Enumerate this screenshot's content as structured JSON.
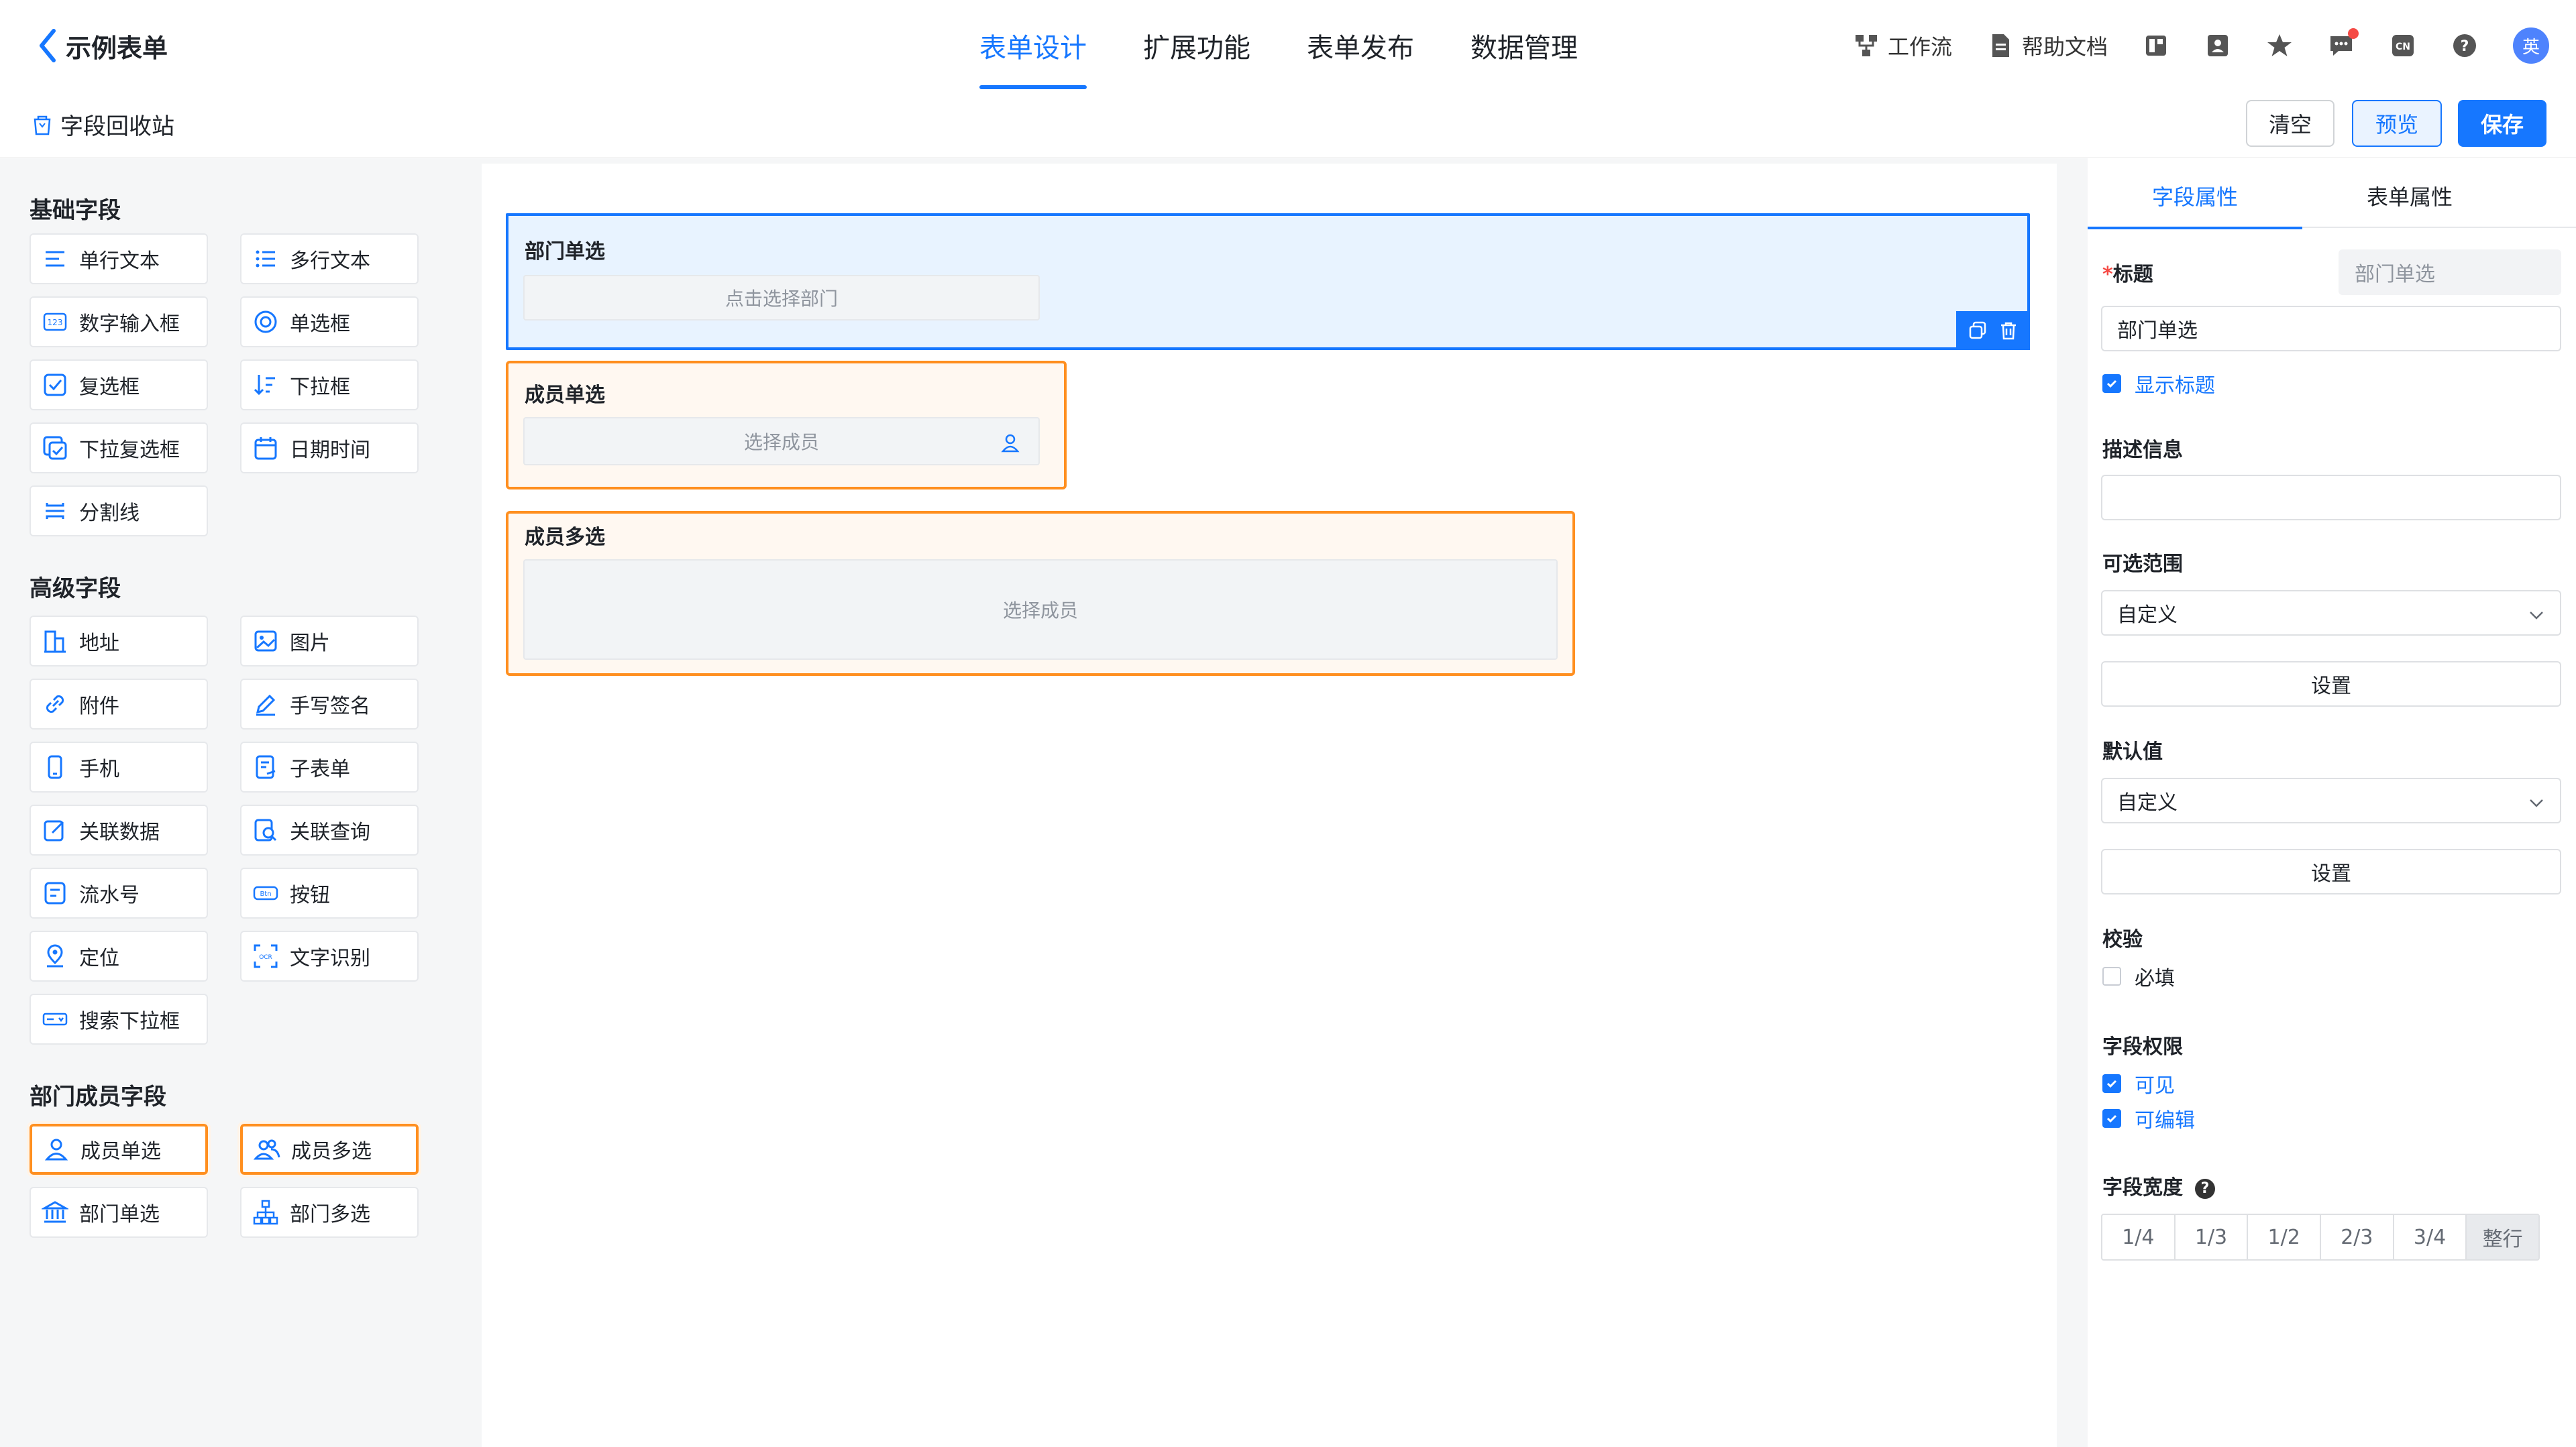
{
  "header": {
    "back_title": "示例表单",
    "tabs": [
      {
        "label": "表单设计",
        "active": true
      },
      {
        "label": "扩展功能",
        "active": false
      },
      {
        "label": "表单发布",
        "active": false
      },
      {
        "label": "数据管理",
        "active": false
      }
    ],
    "tools": {
      "workflow": "工作流",
      "help_docs": "帮助文档",
      "avatar_text": "英"
    }
  },
  "toolbar": {
    "recycle_bin": "字段回收站",
    "clear": "清空",
    "preview": "预览",
    "save": "保存"
  },
  "palette": {
    "basic_title": "基础字段",
    "basic": [
      "单行文本",
      "多行文本",
      "数字输入框",
      "单选框",
      "复选框",
      "下拉框",
      "下拉复选框",
      "日期时间",
      "分割线"
    ],
    "advanced_title": "高级字段",
    "advanced": [
      "地址",
      "图片",
      "附件",
      "手写签名",
      "手机",
      "子表单",
      "关联数据",
      "关联查询",
      "流水号",
      "按钮",
      "定位",
      "文字识别",
      "搜索下拉框"
    ],
    "org_title": "部门成员字段",
    "org": [
      "成员单选",
      "成员多选",
      "部门单选",
      "部门多选"
    ]
  },
  "canvas": {
    "dept_single": {
      "label": "部门单选",
      "placeholder": "点击选择部门"
    },
    "member_single": {
      "label": "成员单选",
      "placeholder": "选择成员"
    },
    "member_multi": {
      "label": "成员多选",
      "placeholder": "选择成员"
    }
  },
  "props": {
    "tabs": [
      "字段属性",
      "表单属性"
    ],
    "title_label": "标题",
    "title_required_mark": "*",
    "title_ghost": "部门单选",
    "title_value": "部门单选",
    "show_title": "显示标题",
    "desc_label": "描述信息",
    "range_label": "可选范围",
    "range_value": "自定义",
    "range_setting": "设置",
    "default_label": "默认值",
    "default_value": "自定义",
    "default_setting": "设置",
    "validate_label": "校验",
    "required_option": "必填",
    "perm_label": "字段权限",
    "visible_option": "可见",
    "editable_option": "可编辑",
    "width_label": "字段宽度",
    "width_help": "?",
    "width_options": [
      "1/4",
      "1/3",
      "1/2",
      "2/3",
      "3/4",
      "整行"
    ],
    "width_selected": "整行"
  },
  "colors": {
    "accent": "#1677ff",
    "highlight": "#ff8f1f",
    "panel_bg": "#f5f6f7"
  }
}
